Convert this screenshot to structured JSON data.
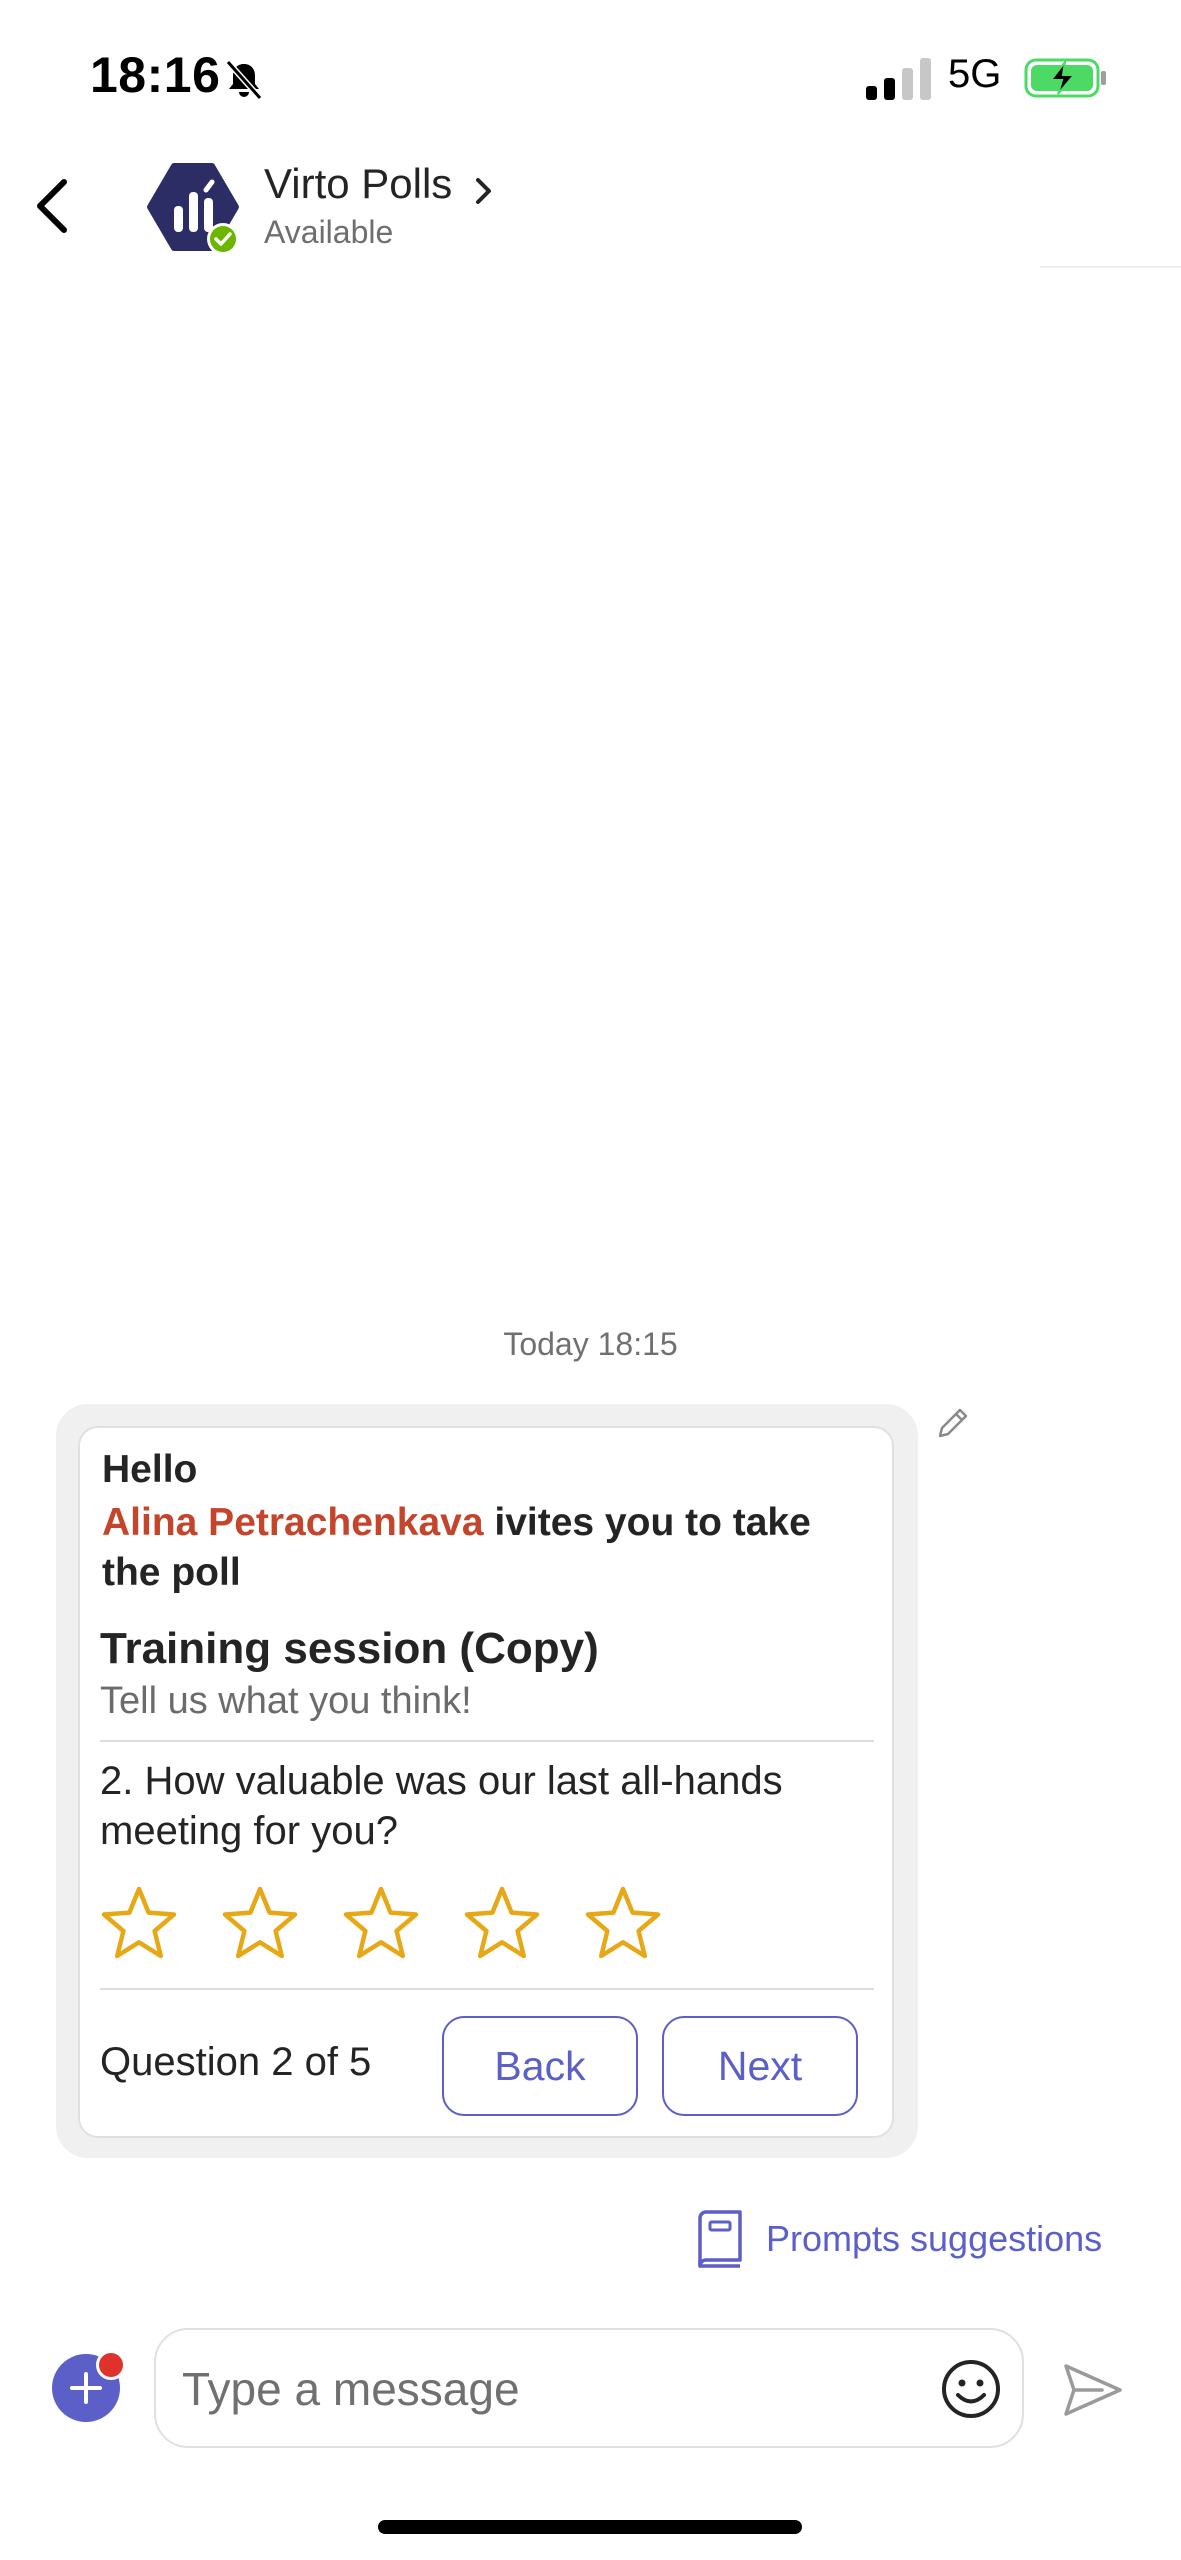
{
  "status_bar": {
    "time": "18:16",
    "network": "5G",
    "icons": [
      "bell-slash-icon",
      "signal-icon",
      "battery-charging-icon"
    ]
  },
  "header": {
    "title": "Virto Polls",
    "status": "Available",
    "icons": [
      "chevron-left-icon",
      "bot-avatar",
      "presence-available-icon",
      "chevron-right-icon"
    ]
  },
  "conversation": {
    "timestamp": "Today 18:15"
  },
  "card": {
    "greeting": "Hello",
    "inviter": "Alina Petrachenkava",
    "invite_text": " ivites you to take the poll",
    "poll_title": "Training session (Copy)",
    "poll_subtitle": "Tell us what you think!",
    "question": "2. How valuable was our last all-hands meeting for you?",
    "rating": {
      "max": 5,
      "selected": 0
    },
    "progress": "Question 2 of 5",
    "back_label": "Back",
    "next_label": "Next",
    "colors": {
      "inviter": "#c4452b",
      "star": "#e6a817",
      "accent": "#5b5fc7"
    }
  },
  "prompts": {
    "label": "Prompts suggestions",
    "icon": "book-icon"
  },
  "compose": {
    "placeholder": "Type a message",
    "icons": [
      "plus-icon",
      "emoji-icon",
      "send-icon"
    ]
  }
}
